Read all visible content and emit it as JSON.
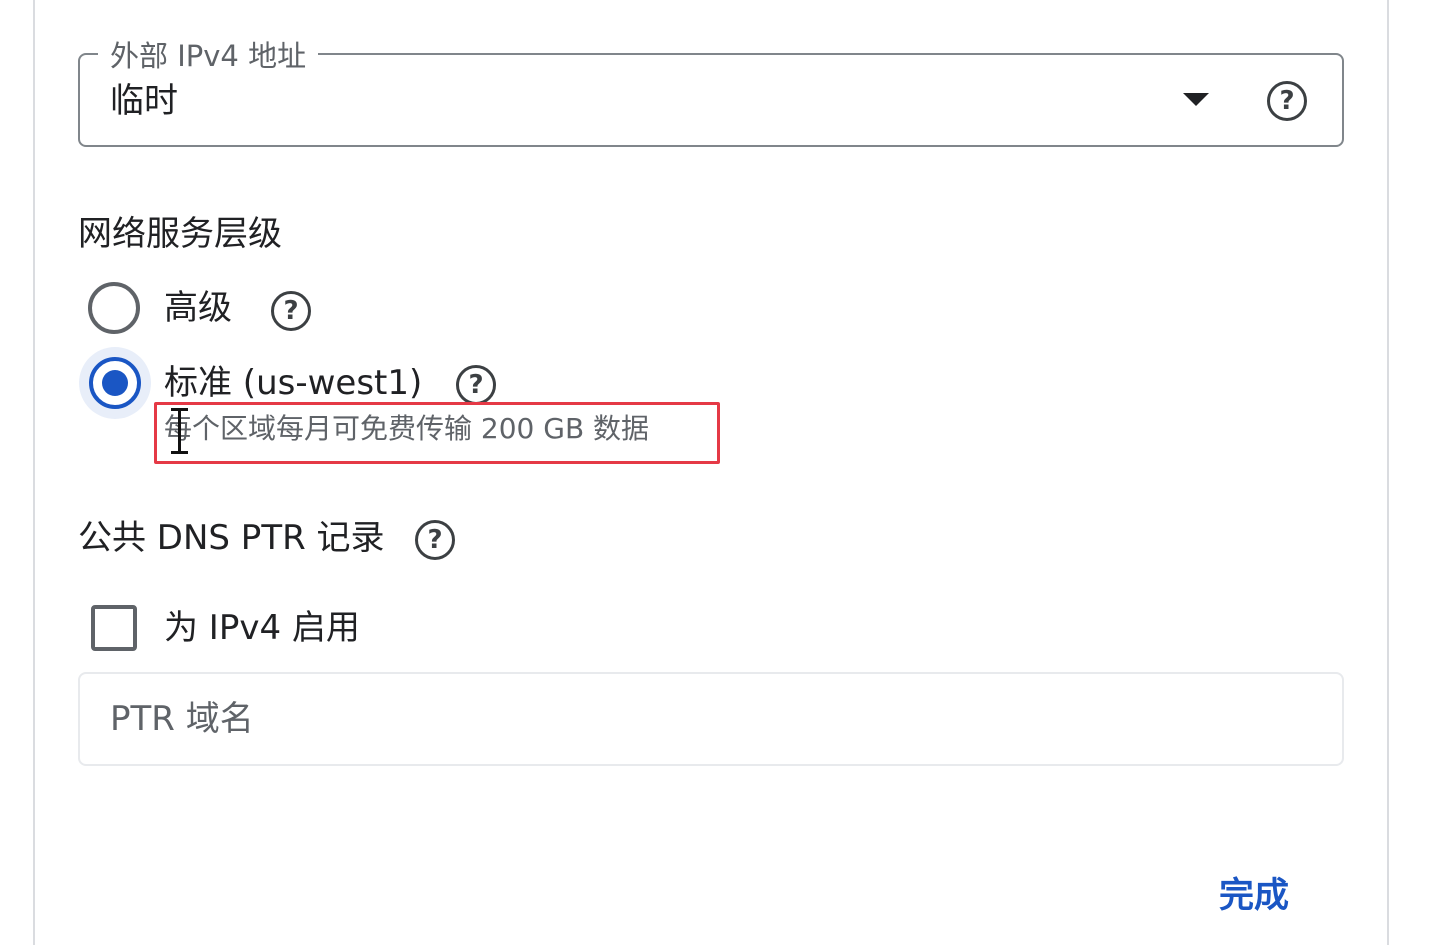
{
  "external_ip": {
    "legend": "外部 IPv4 地址",
    "value": "临时"
  },
  "network_tier": {
    "title": "网络服务层级",
    "options": [
      {
        "label": "高级",
        "selected": false
      },
      {
        "label": "标准 (us-west1)",
        "selected": true
      }
    ],
    "hint": "每个区域每月可免费传输 200 GB 数据"
  },
  "dns_ptr": {
    "title": "公共 DNS PTR 记录",
    "checkbox_label": "为 IPv4 启用",
    "checked": false,
    "input_placeholder": "PTR 域名"
  },
  "footer": {
    "done_label": "完成"
  },
  "icons": {
    "help_glyph": "?"
  },
  "colors": {
    "accent": "#1a56c4",
    "highlight_border": "#e53946"
  }
}
